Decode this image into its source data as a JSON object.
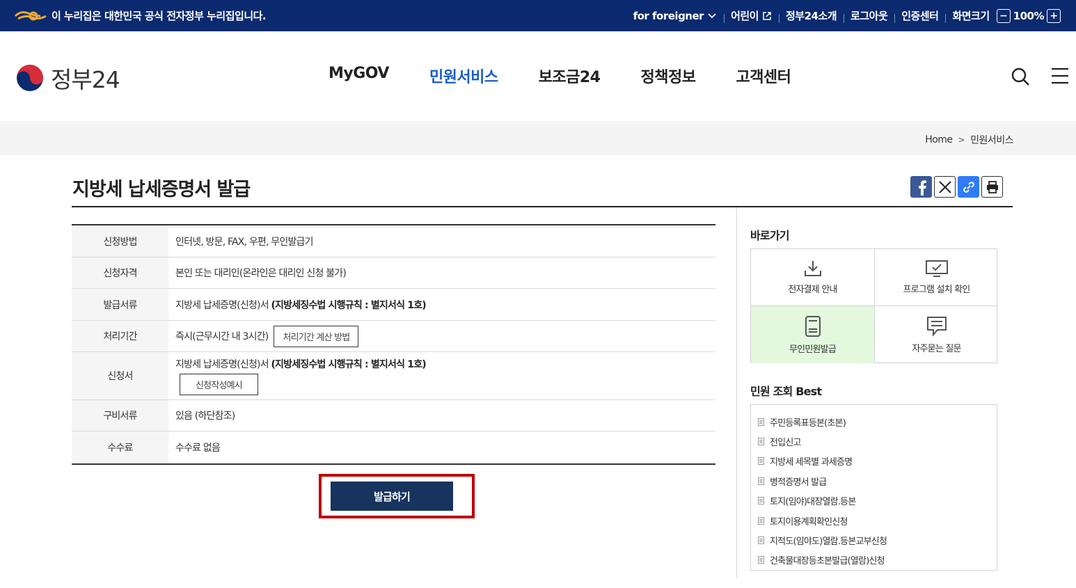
{
  "top_banner": {
    "gov_notice": "이 누리집은 대한민국 공식 전자정부 누리집입니다.",
    "utility": {
      "foreigner": "for foreigner",
      "kids": "어린이",
      "about": "정부24소개",
      "logout": "로그아웃",
      "cert_center": "인증센터",
      "screen_size_label": "화면크기",
      "zoom_minus": "−",
      "zoom_value": "100%",
      "zoom_plus": "+"
    }
  },
  "header": {
    "logo_text": "정부24",
    "nav": [
      "MyGOV",
      "민원서비스",
      "보조금24",
      "정책정보",
      "고객센터"
    ],
    "active_nav": "민원서비스"
  },
  "breadcrumb": [
    "Home",
    "민원서비스"
  ],
  "page": {
    "title": "지방세 납세증명서 발급"
  },
  "info_table": {
    "rows": [
      {
        "label": "신청방법",
        "value": "인터넷, 방문, FAX, 우편, 무인발급기"
      },
      {
        "label": "신청자격",
        "value": "본인 또는 대리인(온라인은 대리인 신청 불가)"
      },
      {
        "label": "발급서류",
        "value": "지방세 납세증명(신청)서",
        "value_bold": "(지방세징수법 시행규칙 : 별지서식 1호)"
      },
      {
        "label": "처리기간",
        "value": "즉시(근무시간 내 3시간)",
        "button": "처리기간 계산 방법"
      },
      {
        "label": "신청서",
        "value": "지방세 납세증명(신청)서",
        "value_bold": "(지방세징수법 시행규칙 : 별지서식 1호)",
        "button": "신청작성예시"
      },
      {
        "label": "구비서류",
        "value": "있음 (하단참조)"
      },
      {
        "label": "수수료",
        "value": "수수료 없음"
      }
    ]
  },
  "primary_action": {
    "label": "발급하기"
  },
  "sidebar": {
    "shortcuts_title": "바로가기",
    "shortcuts": [
      {
        "label": "전자결제 안내",
        "icon": "download-icon"
      },
      {
        "label": "프로그램 설치 확인",
        "icon": "monitor-check-icon"
      },
      {
        "label": "무인민원발급",
        "icon": "kiosk-icon"
      },
      {
        "label": "자주묻는 질문",
        "icon": "chat-icon"
      }
    ],
    "best_title": "민원 조회 Best",
    "best_items": [
      "주민등록표등본(초본)",
      "전입신고",
      "지방세 세목별 과세증명",
      "병적증명서 발급",
      "토지(임야)대장열람.등본",
      "토지이용계획확인신청",
      "지적도(임야도)열람.등본교부신청",
      "건축물대장등초본발급(열람)신청"
    ]
  },
  "colors": {
    "banner_bg": "#0b2a6f",
    "nav_active": "#1a5bc4",
    "primary_btn": "#17345f",
    "highlight_border": "#c00000",
    "kiosk_bg": "#e3f8dd"
  }
}
